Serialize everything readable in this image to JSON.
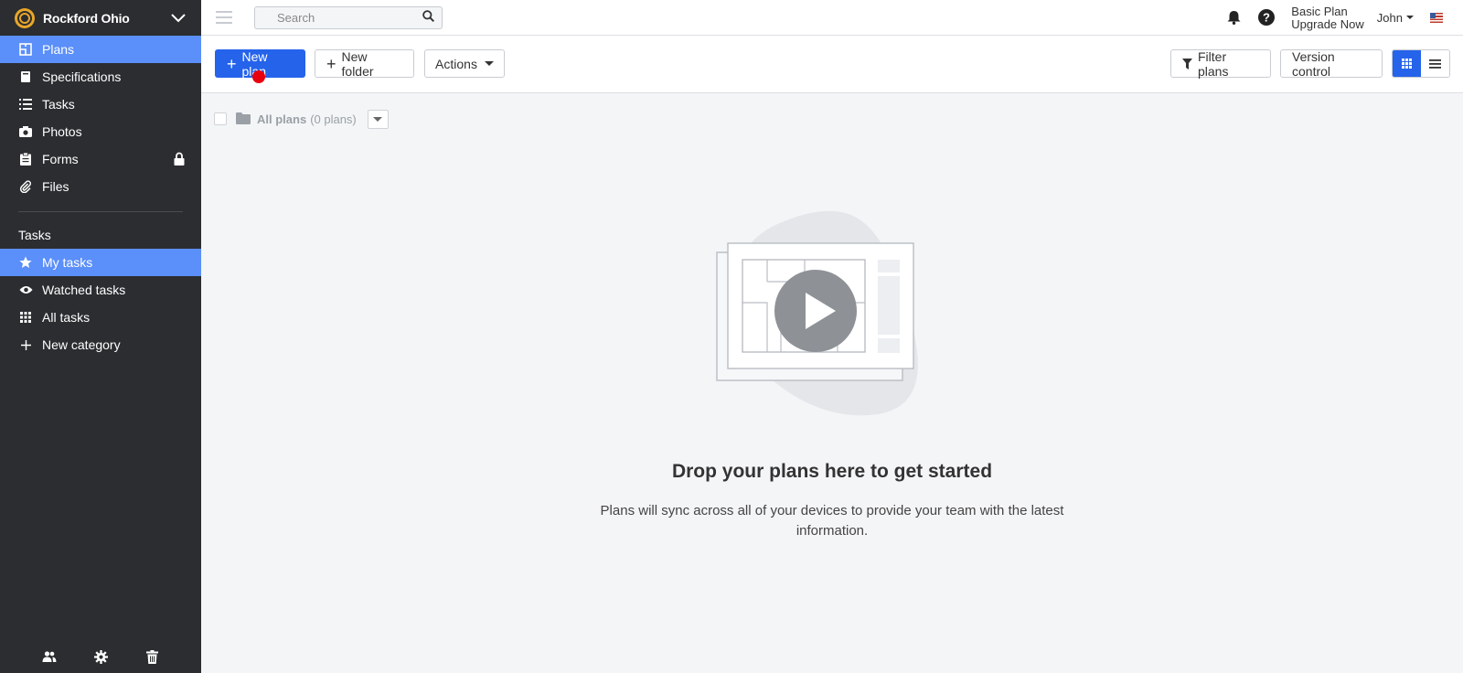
{
  "sidebar": {
    "project_name": "Rockford Ohio",
    "nav": [
      {
        "label": "Plans",
        "icon": "plans-icon",
        "active": true
      },
      {
        "label": "Specifications",
        "icon": "book-icon"
      },
      {
        "label": "Tasks",
        "icon": "list-icon"
      },
      {
        "label": "Photos",
        "icon": "camera-icon"
      },
      {
        "label": "Forms",
        "icon": "clipboard-icon",
        "locked": true
      },
      {
        "label": "Files",
        "icon": "paperclip-icon"
      }
    ],
    "tasks_section_label": "Tasks",
    "task_nav": [
      {
        "label": "My tasks",
        "icon": "star-icon",
        "active": true
      },
      {
        "label": "Watched tasks",
        "icon": "eye-icon"
      },
      {
        "label": "All tasks",
        "icon": "grid-icon"
      },
      {
        "label": "New category",
        "icon": "plus-icon"
      }
    ],
    "footer_icons": [
      "users-icon",
      "gear-icon",
      "trash-icon"
    ]
  },
  "topbar": {
    "search_placeholder": "Search",
    "plan_name": "Basic Plan",
    "upgrade_label": "Upgrade Now",
    "user_name": "John",
    "icons": [
      "bell-icon",
      "help-icon",
      "us-flag-icon"
    ]
  },
  "toolbar": {
    "new_plan_label": "New plan",
    "new_folder_label": "New folder",
    "actions_label": "Actions",
    "filter_label": "Filter plans",
    "version_label": "Version control"
  },
  "folder": {
    "label": "All plans",
    "count": "(0 plans)"
  },
  "empty_state": {
    "title": "Drop your plans here to get started",
    "description": "Plans will sync across all of your devices to provide your team with the latest information."
  },
  "colors": {
    "sidebar_bg": "#2b2d30",
    "active_bg": "#5b8ff9",
    "primary": "#2563eb",
    "content_bg": "#f4f5f7"
  }
}
